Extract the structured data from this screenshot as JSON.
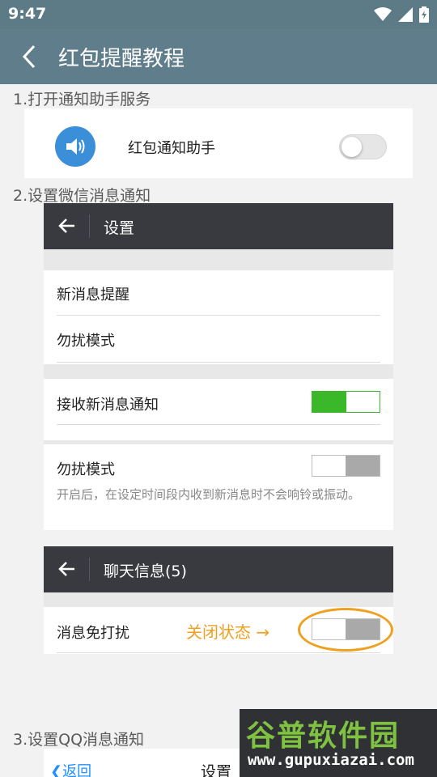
{
  "status_bar": {
    "time": "9:47",
    "icons": [
      "wifi-icon",
      "signal-icon",
      "battery-icon"
    ]
  },
  "app_bar": {
    "title": "红包提醒教程",
    "back_icon": "chevron-left-icon"
  },
  "step1": {
    "label": "1.打开通知助手服务",
    "item_label": "红包通知助手",
    "switch_state": "off",
    "icon": "speaker-icon",
    "icon_color": "#3b8fd8"
  },
  "step2": {
    "label": "2.设置微信消息通知",
    "settings_title": "设置",
    "new_msg_reminder": "新消息提醒",
    "dnd_mode": "勿扰模式",
    "receive_notifications": "接收新消息通知",
    "receive_switch": "on",
    "dnd_label": "勿扰模式",
    "dnd_switch": "off",
    "dnd_desc": "开启后，在设定时间段内收到新消息时不会响铃或振动。",
    "chat_title": "聊天信息(5)",
    "mute_label": "消息免打扰",
    "mute_switch": "off",
    "annotation": "关闭状态 →",
    "accent_green": "#3bb82a",
    "accent_orange": "#f0a020"
  },
  "step3": {
    "label": "3.设置QQ消息通知",
    "back_label": "返回",
    "title": "设置"
  },
  "watermark": {
    "brand": "谷普软件园",
    "url": "www.gupuxiazai.com"
  }
}
